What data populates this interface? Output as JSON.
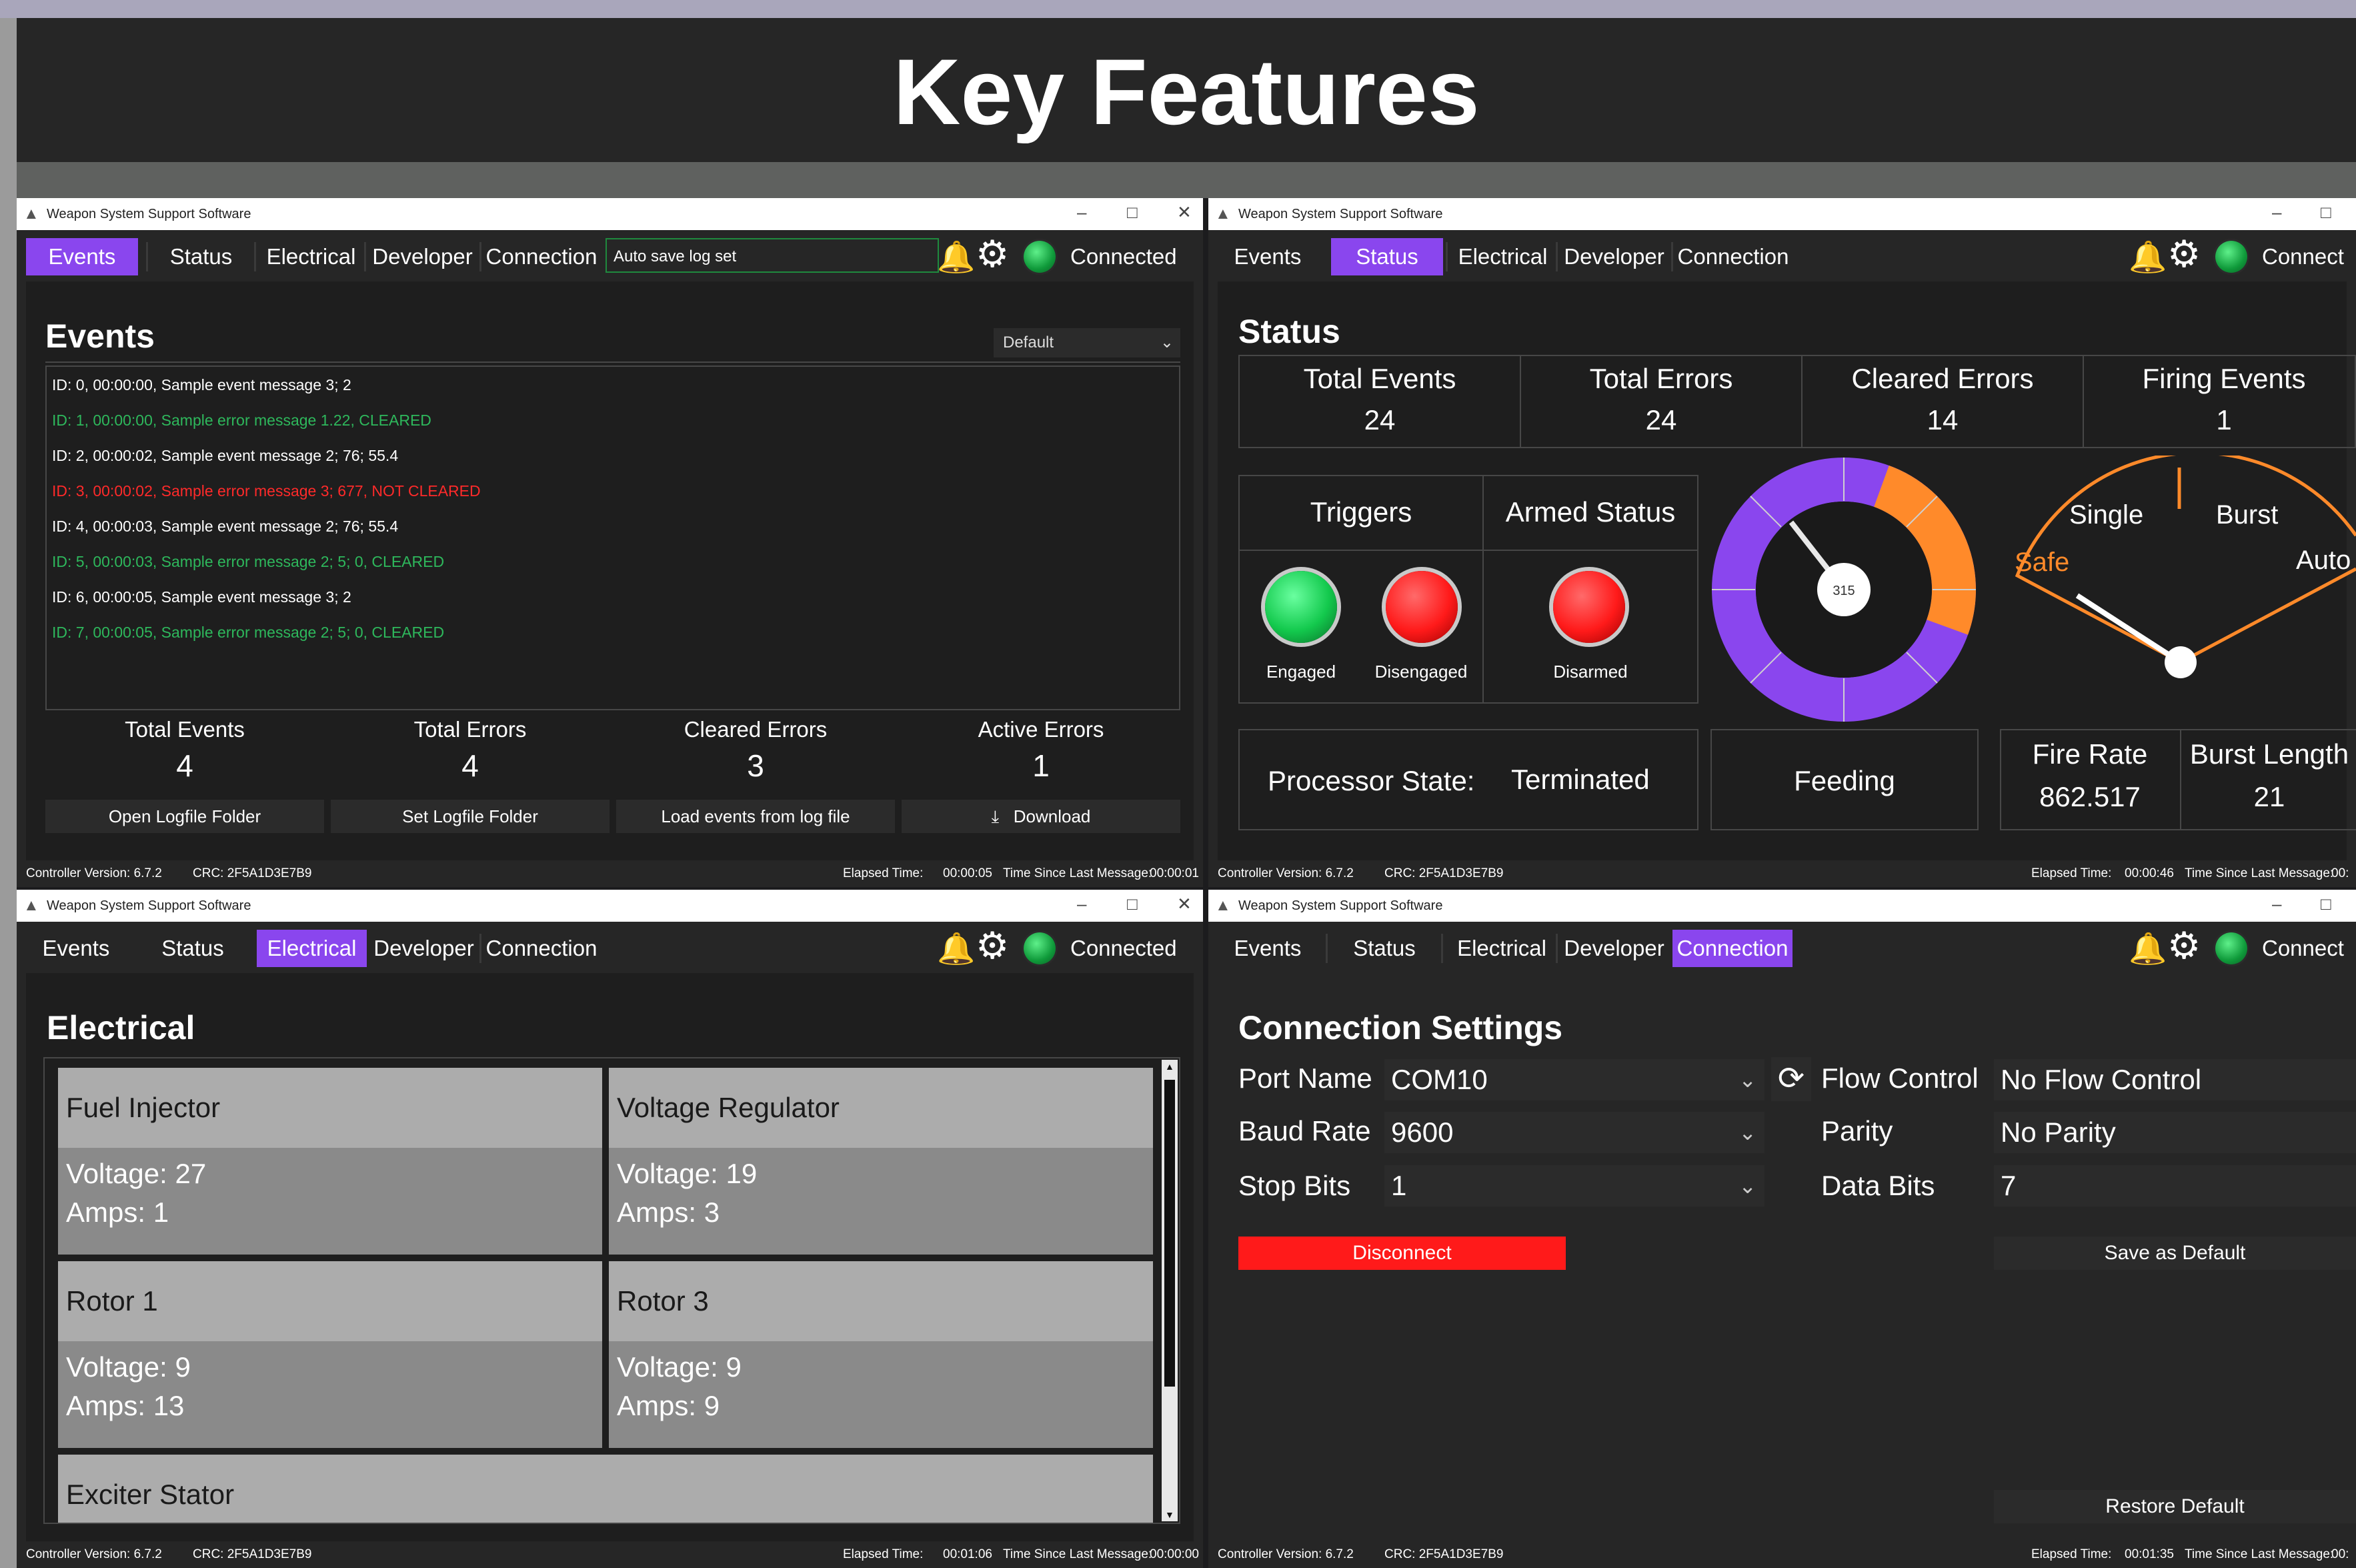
{
  "banner": {
    "title": "Key Features"
  },
  "app": {
    "title": "Weapon System Support Software",
    "tabs": [
      "Events",
      "Status",
      "Electrical",
      "Developer",
      "Connection"
    ],
    "connected": "Connected",
    "connected_clipped": "Connect"
  },
  "events_window": {
    "autosave": "Auto save log set",
    "title": "Events",
    "filter": "Default",
    "log": [
      {
        "text": "ID: 0, 00:00:00, Sample event message 3; 2",
        "type": "event"
      },
      {
        "text": "ID: 1, 00:00:00, Sample error message 1.22, CLEARED",
        "type": "cleared"
      },
      {
        "text": "ID: 2, 00:00:02, Sample event message 2; 76; 55.4",
        "type": "event"
      },
      {
        "text": "ID: 3, 00:00:02, Sample error message 3; 677, NOT CLEARED",
        "type": "error"
      },
      {
        "text": "ID: 4, 00:00:03, Sample event message 2; 76; 55.4",
        "type": "event"
      },
      {
        "text": "ID: 5, 00:00:03, Sample error message 2; 5; 0, CLEARED",
        "type": "cleared"
      },
      {
        "text": "ID: 6, 00:00:05, Sample event message 3; 2",
        "type": "event"
      },
      {
        "text": "ID: 7, 00:00:05, Sample error message 2; 5; 0, CLEARED",
        "type": "cleared"
      }
    ],
    "stats": [
      {
        "label": "Total Events",
        "value": "4"
      },
      {
        "label": "Total Errors",
        "value": "4"
      },
      {
        "label": "Cleared Errors",
        "value": "3"
      },
      {
        "label": "Active Errors",
        "value": "1"
      }
    ],
    "buttons": [
      "Open Logfile Folder",
      "Set Logfile Folder",
      "Load events from log file",
      "Download"
    ],
    "footer": {
      "version": "Controller Version: 6.7.2",
      "crc": "CRC: 2F5A1D3E7B9",
      "elapsed_label": "Elapsed Time:",
      "elapsed": "00:00:05",
      "since_label": "Time Since Last Message:",
      "since": "00:00:01"
    }
  },
  "status_window": {
    "title": "Status",
    "stats": [
      {
        "label": "Total Events",
        "value": "24"
      },
      {
        "label": "Total Errors",
        "value": "24"
      },
      {
        "label": "Cleared Errors",
        "value": "14"
      },
      {
        "label": "Firing Events",
        "value": "1"
      }
    ],
    "triggers_label": "Triggers",
    "armed_label": "Armed Status",
    "engaged": "Engaged",
    "disengaged": "Disengaged",
    "disarmed": "Disarmed",
    "dial_value": "315",
    "selector": {
      "safe": "Safe",
      "single": "Single",
      "burst": "Burst",
      "auto": "Auto"
    },
    "processor_label": "Processor State:",
    "processor_value": "Terminated",
    "feeding": "Feeding",
    "fire_rate_label": "Fire Rate",
    "fire_rate": "862.517",
    "burst_label": "Burst Length",
    "burst": "21",
    "footer": {
      "version": "Controller Version: 6.7.2",
      "crc": "CRC: 2F5A1D3E7B9",
      "elapsed_label": "Elapsed Time:",
      "elapsed": "00:00:46",
      "since_label": "Time Since Last Message:",
      "since": "00:"
    }
  },
  "electrical_window": {
    "title": "Electrical",
    "components": [
      {
        "name": "Fuel Injector",
        "voltage": "Voltage: 27",
        "amps": "Amps: 1"
      },
      {
        "name": "Voltage Regulator",
        "voltage": "Voltage: 19",
        "amps": "Amps: 3"
      },
      {
        "name": "Rotor 1",
        "voltage": "Voltage: 9",
        "amps": "Amps: 13"
      },
      {
        "name": "Rotor 3",
        "voltage": "Voltage: 9",
        "amps": "Amps: 9"
      },
      {
        "name": "Exciter Stator"
      }
    ],
    "footer": {
      "version": "Controller Version: 6.7.2",
      "crc": "CRC: 2F5A1D3E7B9",
      "elapsed_label": "Elapsed Time:",
      "elapsed": "00:01:06",
      "since_label": "Time Since Last Message:",
      "since": "00:00:00"
    }
  },
  "connection_window": {
    "title": "Connection Settings",
    "port_label": "Port Name",
    "port": "COM10",
    "baud_label": "Baud Rate",
    "baud": "9600",
    "stop_label": "Stop Bits",
    "stop": "1",
    "flow_label": "Flow Control",
    "flow": "No Flow Control",
    "parity_label": "Parity",
    "parity": "No Parity",
    "data_label": "Data Bits",
    "data": "7",
    "disconnect": "Disconnect",
    "save_default": "Save as Default",
    "restore_default": "Restore Default",
    "footer": {
      "version": "Controller Version: 6.7.2",
      "crc": "CRC: 2F5A1D3E7B9",
      "elapsed_label": "Elapsed Time:",
      "elapsed": "00:01:35",
      "since_label": "Time Since Last Message:",
      "since": "00:"
    }
  },
  "colors": {
    "accent": "#8a46ee",
    "event_text": "#ffffff",
    "cleared_text": "#2eb85c",
    "error_text": "#ff2a2a",
    "disconnect": "#ff1a1a",
    "dial_orange": "#ff8a2a",
    "dial_purple": "#8a46ee"
  }
}
